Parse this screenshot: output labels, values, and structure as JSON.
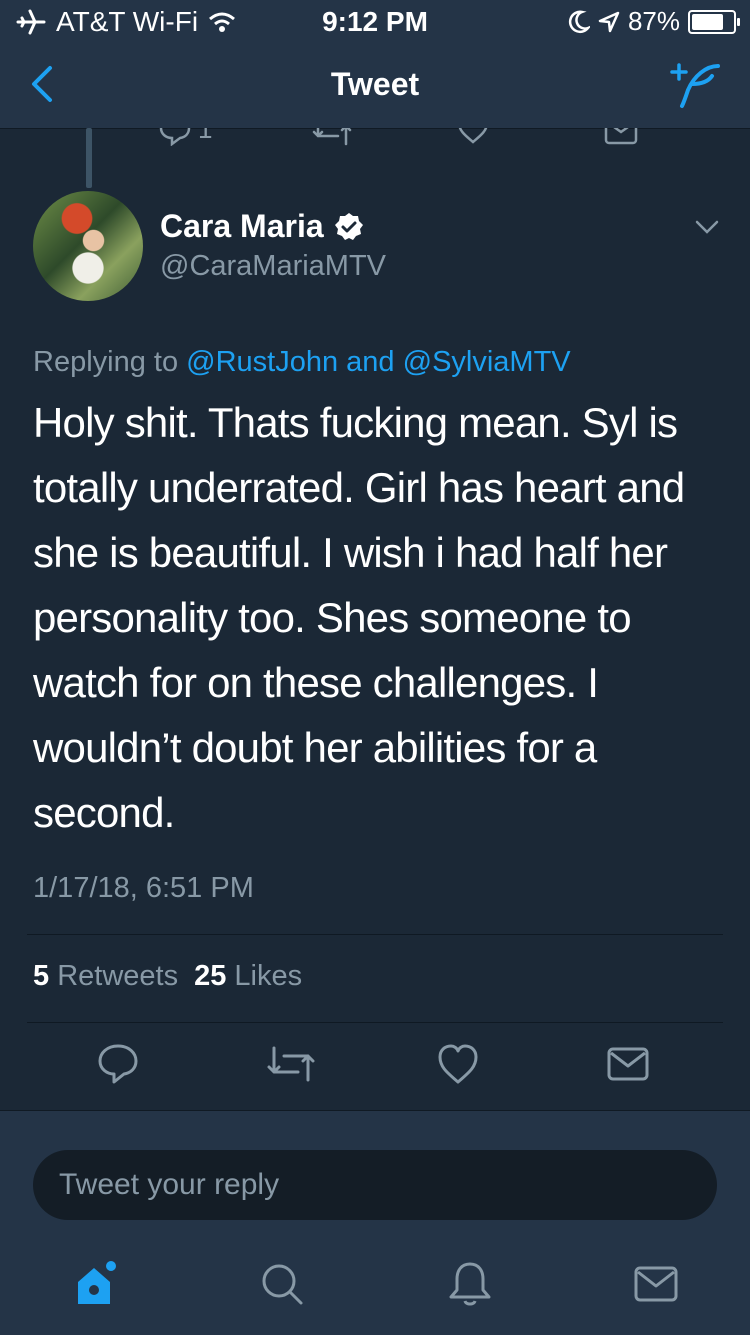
{
  "status_bar": {
    "carrier": "AT&T Wi-Fi",
    "time": "9:12 PM",
    "battery": "87%",
    "battery_level": 0.87,
    "icons": [
      "airplane-icon",
      "wifi-icon",
      "moon-icon",
      "location-icon",
      "battery-icon"
    ]
  },
  "nav": {
    "title": "Tweet",
    "back_icon": "chevron-left-icon",
    "compose_icon": "compose-tweet-icon"
  },
  "previous_tweet": {
    "reply_count": "1"
  },
  "tweet": {
    "author_name": "Cara Maria",
    "author_handle": "@CaraMariaMTV",
    "replying_prefix": "Replying to",
    "replying_to_1": "@RustJohn",
    "replying_and": "and",
    "replying_to_2": "@SylviaMTV",
    "text": "Holy shit. Thats fucking mean. Syl is totally underrated. Girl has heart and she is beautiful. I wish i had half her personality too. Shes someone to watch for on these challenges. I wouldn’t doubt her abilities for a second.",
    "timestamp": "1/17/18, 6:51 PM",
    "retweets_count": "5",
    "retweets_label": "Retweets",
    "likes_count": "25",
    "likes_label": "Likes"
  },
  "reply": {
    "placeholder": "Tweet your reply"
  },
  "tab_bar": [
    "home-icon",
    "search-icon",
    "notifications-icon",
    "messages-icon"
  ],
  "colors": {
    "background": "#1b2836",
    "bar": "#243447",
    "accent": "#1da1f2",
    "muted": "#8899a6"
  }
}
